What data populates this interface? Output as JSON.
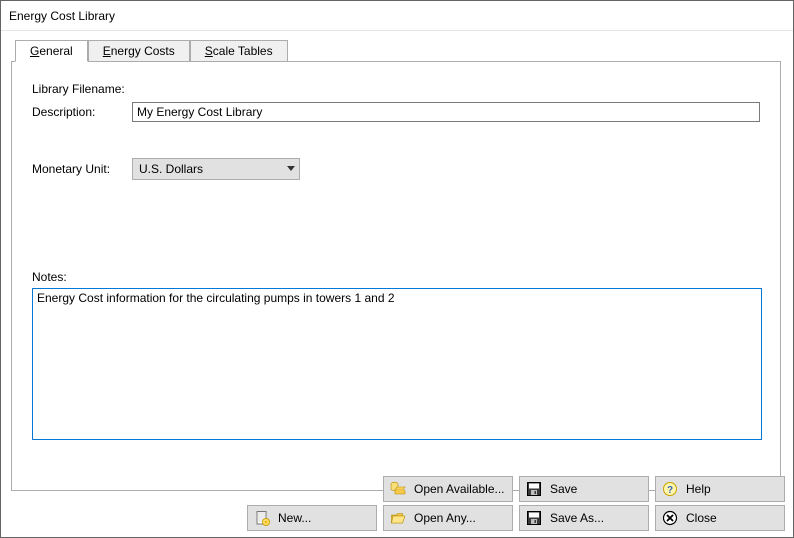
{
  "window": {
    "title": "Energy Cost Library"
  },
  "tabs": {
    "general": {
      "label": "General",
      "accel_index": 0
    },
    "energy_costs": {
      "label": "Energy Costs",
      "accel_index": 0
    },
    "scale_tables": {
      "label": "Scale Tables",
      "accel_index": 0
    }
  },
  "general_page": {
    "library_filename_label": "Library Filename:",
    "description_label": "Description:",
    "description_value": "My Energy Cost Library",
    "monetary_unit_label": "Monetary Unit:",
    "monetary_unit_value": "U.S. Dollars",
    "notes_label": "Notes:",
    "notes_value": "Energy Cost information for the circulating pumps in towers 1 and 2"
  },
  "buttons": {
    "open_available": "Open Available...",
    "save": "Save",
    "help": "Help",
    "new": "New...",
    "open_any": "Open Any...",
    "save_as": "Save As...",
    "close": "Close"
  }
}
